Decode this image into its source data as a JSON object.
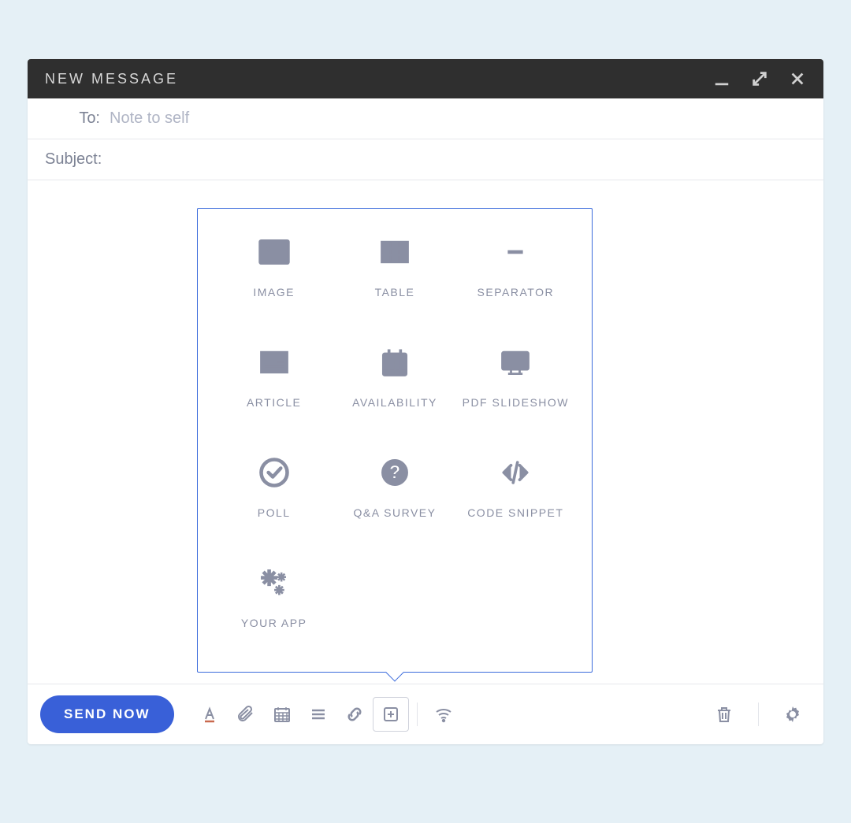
{
  "header": {
    "title": "NEW MESSAGE"
  },
  "fields": {
    "to_label": "To:",
    "to_placeholder": "Note to self",
    "subject_label": "Subject:"
  },
  "insert_menu": {
    "items": [
      {
        "label": "IMAGE",
        "icon": "image-icon"
      },
      {
        "label": "TABLE",
        "icon": "table-icon"
      },
      {
        "label": "SEPARATOR",
        "icon": "separator-icon"
      },
      {
        "label": "ARTICLE",
        "icon": "article-icon"
      },
      {
        "label": "AVAILABILITY",
        "icon": "availability-icon"
      },
      {
        "label": "PDF SLIDESHOW",
        "icon": "pdf-slideshow-icon"
      },
      {
        "label": "POLL",
        "icon": "poll-icon"
      },
      {
        "label": "Q&A SURVEY",
        "icon": "qa-survey-icon"
      },
      {
        "label": "CODE SNIPPET",
        "icon": "code-snippet-icon"
      },
      {
        "label": "YOUR APP",
        "icon": "your-app-icon"
      }
    ]
  },
  "footer": {
    "send_label": "SEND NOW"
  }
}
